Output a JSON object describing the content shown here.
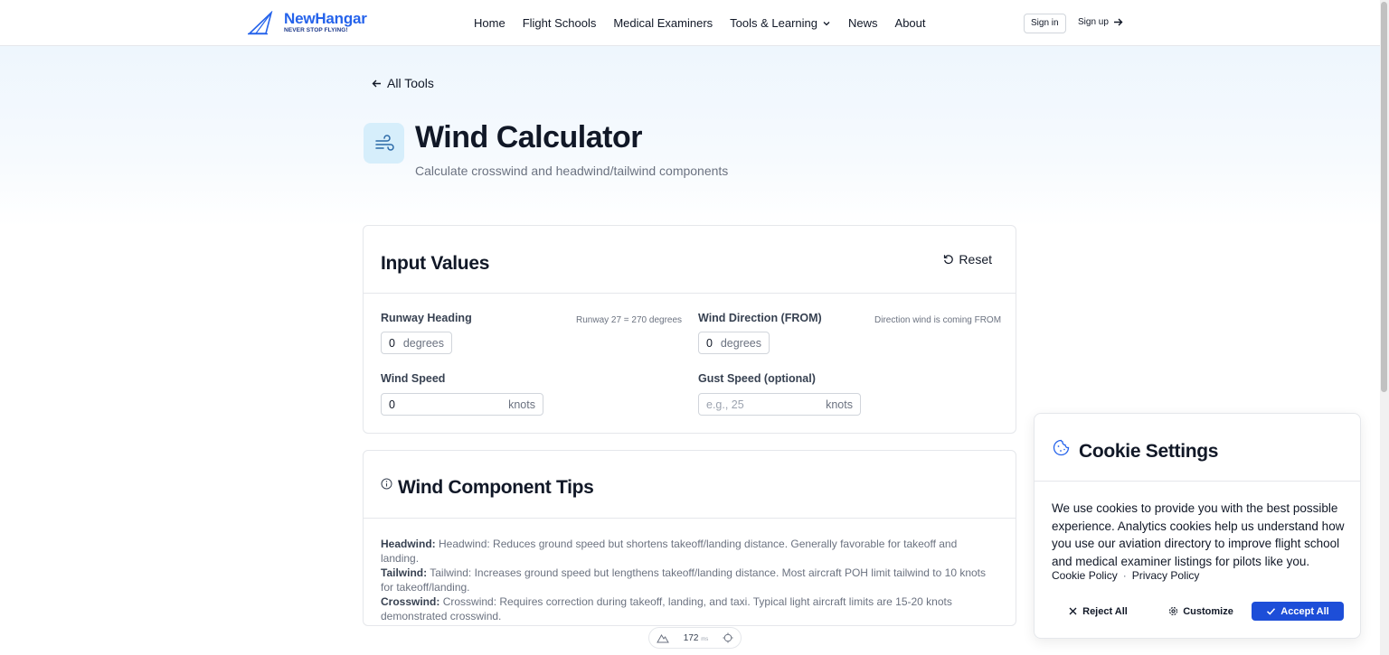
{
  "header": {
    "logo_name": "NewHangar",
    "logo_tagline": "NEVER STOP FLYING!",
    "nav": [
      "Home",
      "Flight Schools",
      "Medical Examiners",
      "Tools & Learning",
      "News",
      "About"
    ],
    "signin": "Sign in",
    "signup": "Sign up"
  },
  "page": {
    "back": "All Tools",
    "title": "Wind Calculator",
    "subtitle": "Calculate crosswind and headwind/tailwind components"
  },
  "inputs_card": {
    "title": "Input Values",
    "reset": "Reset",
    "runway_heading": {
      "label": "Runway Heading",
      "hint": "Runway 27 = 270 degrees",
      "value": "0",
      "unit": "degrees"
    },
    "wind_direction": {
      "label": "Wind Direction (FROM)",
      "hint": "Direction wind is coming FROM",
      "value": "0",
      "unit": "degrees"
    },
    "wind_speed": {
      "label": "Wind Speed",
      "value": "0",
      "unit": "knots"
    },
    "gust_speed": {
      "label": "Gust Speed (optional)",
      "placeholder": "e.g., 25",
      "unit": "knots"
    }
  },
  "tips_card": {
    "title": "Wind Component Tips",
    "headwind_label": "Headwind:",
    "headwind_text": "Headwind: Reduces ground speed but shortens takeoff/landing distance. Generally favorable for takeoff and landing.",
    "tailwind_label": "Tailwind:",
    "tailwind_text": "Tailwind: Increases ground speed but lengthens takeoff/landing distance. Most aircraft POH limit tailwind to 10 knots for takeoff/landing.",
    "crosswind_label": "Crosswind:",
    "crosswind_text": "Crosswind: Requires correction during takeoff, landing, and taxi. Typical light aircraft limits are 15-20 knots demonstrated crosswind."
  },
  "perf": {
    "value": "172",
    "unit": "ms"
  },
  "cookie": {
    "title": "Cookie Settings",
    "text": "We use cookies to provide you with the best possible experience. Analytics cookies help us understand how you use our aviation directory to improve flight school and medical examiner listings for pilots like you.",
    "cookie_policy": "Cookie Policy",
    "separator": "·",
    "privacy_policy": "Privacy Policy",
    "reject": "Reject All",
    "customize": "Customize",
    "accept": "Accept All"
  },
  "colors": {
    "brand": "#2563eb",
    "accent_button": "#1d4ed8",
    "icon_bg": "#d6eefb"
  }
}
